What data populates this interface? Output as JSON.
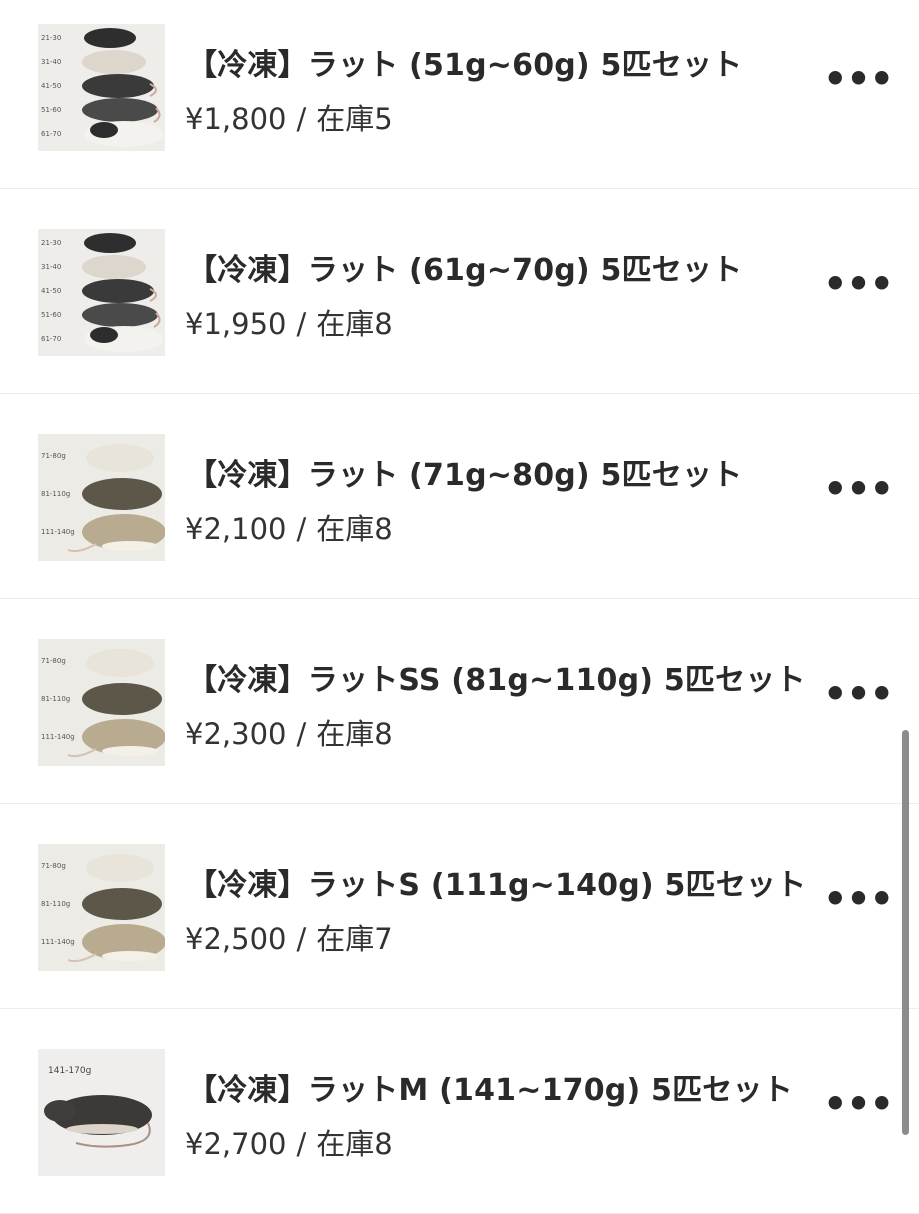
{
  "products": [
    {
      "title": "【冷凍】ラット (51g~60g) 5匹セット",
      "price": "¥1,800",
      "stock": "在庫5",
      "thumbnail": "rat-size-chart-dark"
    },
    {
      "title": "【冷凍】ラット (61g~70g) 5匹セット",
      "price": "¥1,950",
      "stock": "在庫8",
      "thumbnail": "rat-size-chart-dark"
    },
    {
      "title": "【冷凍】ラット (71g~80g) 5匹セット",
      "price": "¥2,100",
      "stock": "在庫8",
      "thumbnail": "rat-size-chart-tan"
    },
    {
      "title": "【冷凍】ラットSS (81g~110g) 5匹セット",
      "price": "¥2,300",
      "stock": "在庫8",
      "thumbnail": "rat-size-chart-tan"
    },
    {
      "title": "【冷凍】ラットS (111g~140g) 5匹セット",
      "price": "¥2,500",
      "stock": "在庫7",
      "thumbnail": "rat-size-chart-tan"
    },
    {
      "title": "【冷凍】ラットM (141~170g) 5匹セット",
      "price": "¥2,700",
      "stock": "在庫8",
      "thumbnail": "rat-single-photo"
    }
  ],
  "separator": "/",
  "more_icon": "more-horizontal-icon",
  "thumb_labels": {
    "dark": [
      "21-30",
      "31-40",
      "41-50",
      "51-60",
      "61-70"
    ],
    "tan": [
      "71-80g",
      "81-110g",
      "111-140g"
    ],
    "single": "141-170g"
  },
  "colors": {
    "text": "#2a2a2a",
    "divider": "#ececec",
    "scrollbar": "#8c8c8c"
  }
}
